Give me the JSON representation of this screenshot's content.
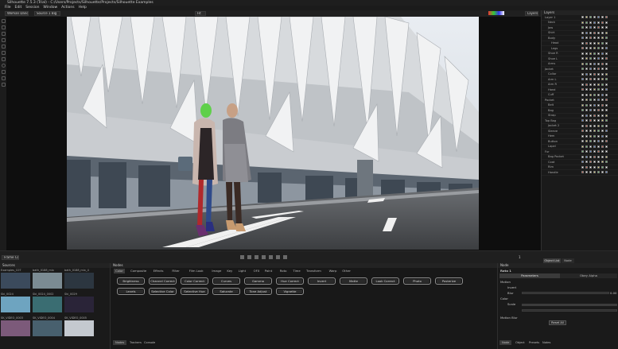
{
  "window": {
    "title": "Silhouette 7.5.3 (Trial) - C:/Users/Projects/Silhouette/Projects/Silhouette Examples"
  },
  "menu": [
    "File",
    "Edit",
    "Session",
    "Window",
    "Actions",
    "Help"
  ],
  "toolbar": {
    "session_select": "Woman Dancing",
    "view_select": "Source 1 Big",
    "zoom": "Fit",
    "layers_label": "Layers"
  },
  "layers": {
    "title": "Layers",
    "items": [
      "Layer 1",
      "Neck",
      "Jaw",
      "Shirt",
      "Body",
      "Head",
      "Legs",
      "Shoe R",
      "Shoe L",
      "Arms",
      "Jacket",
      "Collar",
      "Arm L",
      "Arm R",
      "Hand",
      "Cuff",
      "Pocket",
      "Belt",
      "Bag",
      "Strap",
      "Top Bag",
      "Jacket 2",
      "Sleeve",
      "Hem",
      "Button",
      "Lapel",
      "Fur",
      "Bag Pocket",
      "Coat",
      "Rim",
      "Handle"
    ]
  },
  "transport": {
    "frame_field": "Frame Code",
    "frame_value": "1",
    "view_left": "Object List",
    "view_right": "Node"
  },
  "sources": {
    "title": "Sources",
    "items": [
      {
        "label": "Examples_C07"
      },
      {
        "label": "bath_0188_mix"
      },
      {
        "label": "bath_0188_mix_4"
      },
      {
        "label": "Ski_0024"
      },
      {
        "label": "Ski_0024_0002"
      },
      {
        "label": "Ski_0029"
      },
      {
        "label": "SK_VIDEO_0003"
      },
      {
        "label": "SK_VIDEO_0004"
      },
      {
        "label": "SK_VIDEO_0005"
      }
    ]
  },
  "nodes": {
    "title": "Nodes",
    "tabs": [
      "Color",
      "Composite",
      "Effects",
      "Filter",
      "Film Look",
      "Image",
      "Key",
      "Light",
      "OFX",
      "Paint",
      "Roto",
      "Time",
      "Transform",
      "Warp",
      "Other"
    ],
    "row1": [
      "Brightness",
      "Channel Correct",
      "Color Correct",
      "Curves",
      "Gamma",
      "Hue Correct",
      "Invert",
      "Matte",
      "Look Correct",
      "Photo",
      "Posterize"
    ],
    "row2": [
      "Levels",
      "Selective Color",
      "Selective Hue",
      "Saturate",
      "Tone Adjust",
      "Vignette"
    ],
    "bottom_tabs": [
      "Nodes",
      "Trackers",
      "Console"
    ]
  },
  "props": {
    "title": "Node",
    "header": "Roto 1",
    "tab_a": "Parameters",
    "tab_b": "Obey Alpha",
    "rows": [
      "Motion",
      "Invert",
      "Blur",
      "Color",
      "Scale",
      "Motion Blur"
    ],
    "value": "0.00",
    "reset_label": "Reset All",
    "bottom_tabs": [
      "Node",
      "Object",
      "Presets",
      "Notes"
    ]
  },
  "colors": {
    "accent": "#3d6fb8",
    "node_border": "#8d8d8d"
  }
}
